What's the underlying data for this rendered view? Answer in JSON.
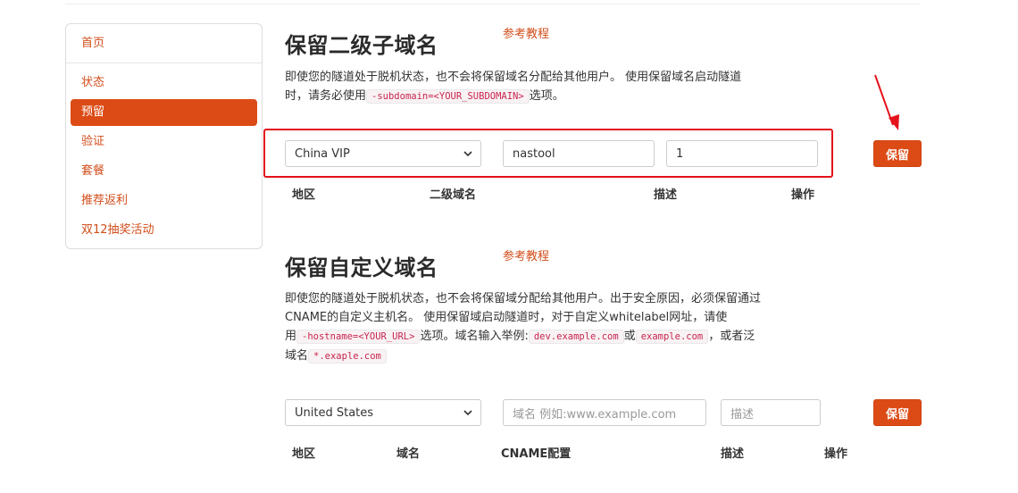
{
  "sidebar": {
    "items": [
      {
        "label": "首页",
        "active": false
      },
      {
        "label": "状态",
        "active": false
      },
      {
        "label": "预留",
        "active": true
      },
      {
        "label": "验证",
        "active": false
      },
      {
        "label": "套餐",
        "active": false
      },
      {
        "label": "推荐返利",
        "active": false
      },
      {
        "label": "双12抽奖活动",
        "active": false
      }
    ]
  },
  "subdomain_section": {
    "title": "保留二级子域名",
    "tutorial_link": "参考教程",
    "desc_line1": "即使您的隧道处于脱机状态，也不会将保留域名分配给其他用户。 使用保留域名启动隧道",
    "desc_line2_before": "时，请务必使用",
    "desc_code": "-subdomain=<YOUR_SUBDOMAIN>",
    "desc_line2_after": "选项。",
    "region_value": "China VIP",
    "subdomain_value": "nastool",
    "description_value": "1",
    "save_label": "保留",
    "headers": [
      "地区",
      "二级域名",
      "描述",
      "操作"
    ]
  },
  "custom_section": {
    "title": "保留自定义域名",
    "tutorial_link": "参考教程",
    "line1": "即使您的隧道处于脱机状态，也不会将保留域分配给其他用户。出于安全原因，必须保留通过",
    "line2": "CNAME的自定义主机名。 使用保留域启动隧道时，对于自定义whitelabel网址，请使",
    "line3_a": "用",
    "code_hostname": "-hostname=<YOUR_URL>",
    "line3_b": "选项。域名输入举例:",
    "code_dev": "dev.example.com",
    "line3_c": "或",
    "code_example": "example.com",
    "line3_d": "，或者泛",
    "line4_a": "域名",
    "code_wildcard": "*.exaple.com",
    "region_value": "United States",
    "domain_placeholder": "域名 例如:www.example.com",
    "description_placeholder": "描述",
    "save_label": "保留",
    "headers": [
      "地区",
      "域名",
      "CNAME配置",
      "描述",
      "操作"
    ]
  },
  "colors": {
    "accent": "#dc4b16",
    "link": "#d24d1b",
    "highlight_box": "#e4121a"
  }
}
